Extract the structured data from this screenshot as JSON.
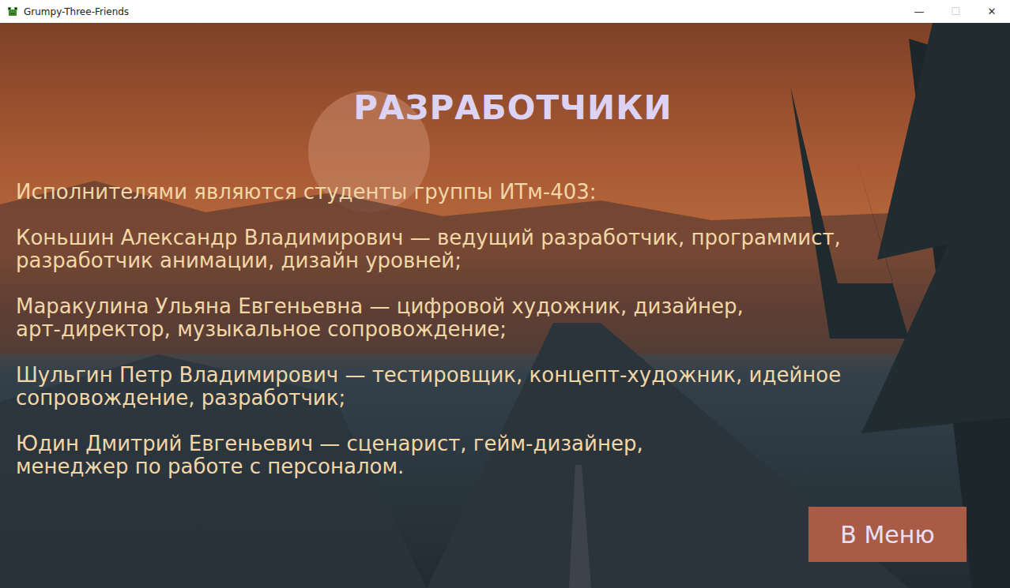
{
  "window": {
    "title": "Grumpy-Three-Friends",
    "controls": [
      {
        "label": "—",
        "disabled": false
      },
      {
        "label": "☐",
        "disabled": true
      },
      {
        "label": "✕",
        "disabled": false
      }
    ]
  },
  "heading": "РАЗРАБОТЧИКИ",
  "intro": "Исполнителями являются студенты группы ИТм-403:",
  "developers": [
    {
      "lines": [
        "Коньшин Александр Владимирович — ведущий разработчик, программист,",
        "разработчик анимации, дизайн уровней;"
      ]
    },
    {
      "lines": [
        "Маракулина Ульяна Евгеньевна — цифровой художник, дизайнер,",
        "арт-директор, музыкальное сопровождение;"
      ]
    },
    {
      "lines": [
        "Шульгин Петр Владимирович — тестировщик, концепт-художник, идейное",
        "сопровождение, разработчик;"
      ]
    },
    {
      "lines": [
        "Юдин Дмитрий Евгеньевич — сценарист, гейм-дизайнер,",
        "менеджер по работе с персоналом."
      ]
    }
  ],
  "menu_button": "В Меню"
}
